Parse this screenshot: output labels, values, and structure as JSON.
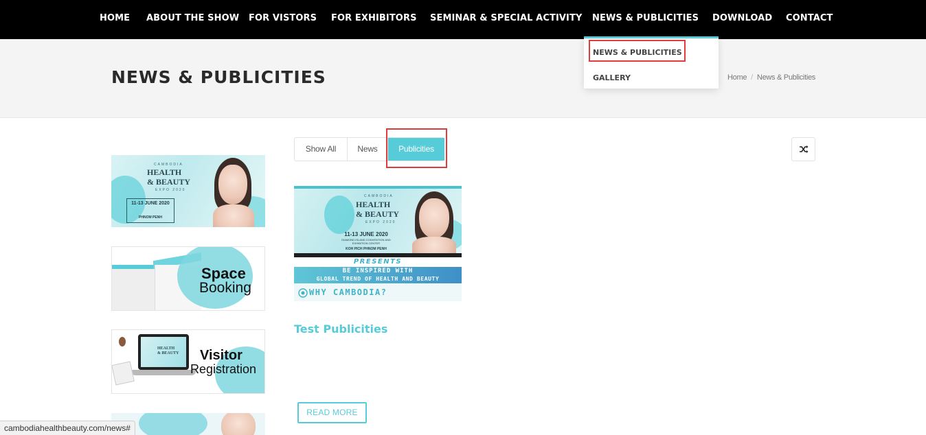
{
  "nav": {
    "items": [
      {
        "label": "HOME"
      },
      {
        "label": "ABOUT THE SHOW"
      },
      {
        "label": "FOR VISTORS"
      },
      {
        "label": "FOR EXHIBITORS"
      },
      {
        "label": "SEMINAR & SPECIAL ACTIVITY"
      },
      {
        "label": "NEWS & PUBLICITIES"
      },
      {
        "label": "DOWNLOAD"
      },
      {
        "label": "CONTACT"
      }
    ]
  },
  "dropdown": {
    "items": [
      {
        "label": "NEWS & PUBLICITIES"
      },
      {
        "label": "GALLERY"
      }
    ]
  },
  "page": {
    "title": "NEWS & PUBLICITIES"
  },
  "breadcrumb": {
    "home": "Home",
    "separator": "/",
    "current": "News & Publicities"
  },
  "sidebar": {
    "banner1": {
      "country": "CAMBODIA",
      "line1": "HEALTH",
      "line2": "& BEAUTY",
      "expo": "EXPO 2020",
      "date": "11-13 JUNE 2020",
      "city": "PHNOM PENH"
    },
    "banner2": {
      "line1": "Space",
      "line2": "Booking"
    },
    "banner3": {
      "line1": "Visitor",
      "line2": "Registration",
      "screen_line1": "HEALTH",
      "screen_line2": "& BEAUTY"
    }
  },
  "filter": {
    "tabs": [
      {
        "label": "Show All"
      },
      {
        "label": "News"
      },
      {
        "label": "Publicities"
      }
    ],
    "active": "Publicities",
    "shuffle_icon": "shuffle-icon"
  },
  "post": {
    "image": {
      "country": "CAMBODIA",
      "line1": "HEALTH",
      "line2": "& BEAUTY",
      "expo": "EXPO 2020",
      "date": "11-13 JUNE 2020",
      "venue": "DIAMOND ISLAND CONVENTION AND EXHIBITION CENTER",
      "city": "KOH PICH   PHNOM PENH",
      "presents": "PRESENTS",
      "inspired1": "BE INSPIRED WITH",
      "inspired2": "GLOBAL TREND OF HEALTH AND BEAUTY",
      "why": "WHY CAMBODIA?"
    },
    "title": "Test Publicities",
    "read_more": "READ MORE"
  },
  "status": {
    "url": "cambodiahealthbeauty.com/news#"
  },
  "colors": {
    "accent": "#56ccd8",
    "nav_bg": "#000000",
    "highlight": "#e03c3c"
  }
}
